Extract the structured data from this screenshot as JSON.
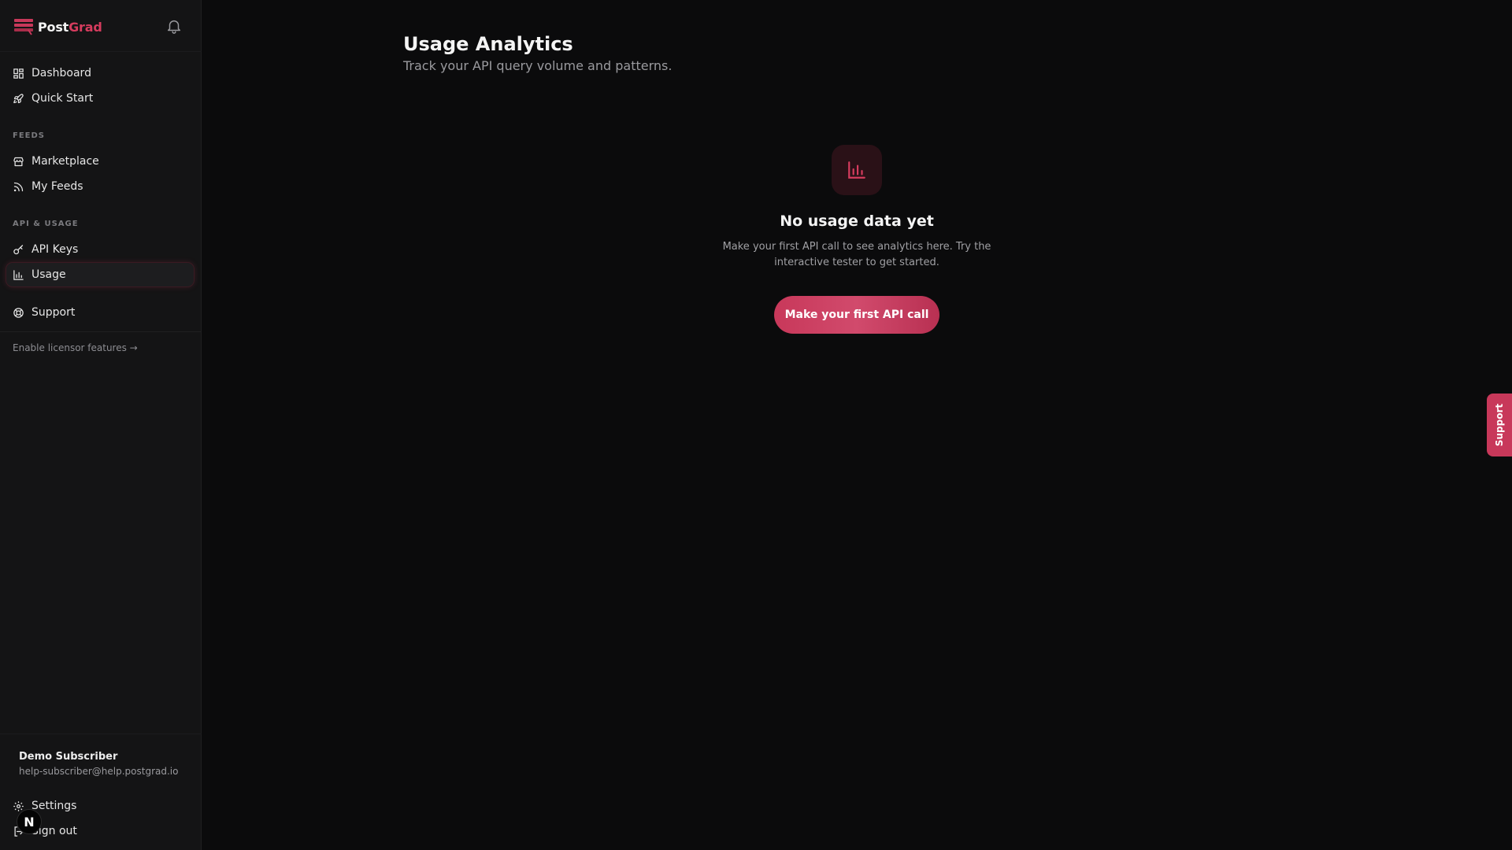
{
  "brand": {
    "name_prefix": "Post",
    "name_suffix": "Grad"
  },
  "sidebar": {
    "primary": [
      {
        "label": "Dashboard",
        "icon": "dashboard-icon"
      },
      {
        "label": "Quick Start",
        "icon": "rocket-icon"
      }
    ],
    "sections": [
      {
        "label": "FEEDS",
        "items": [
          {
            "label": "Marketplace",
            "icon": "store-icon"
          },
          {
            "label": "My Feeds",
            "icon": "rss-icon"
          }
        ]
      },
      {
        "label": "API & USAGE",
        "items": [
          {
            "label": "API Keys",
            "icon": "key-icon"
          },
          {
            "label": "Usage",
            "icon": "bar-chart-icon",
            "active": true
          }
        ]
      }
    ],
    "support": {
      "label": "Support",
      "icon": "lifebuoy-icon"
    },
    "licensor_link": "Enable licensor features →",
    "user": {
      "name": "Demo Subscriber",
      "email": "help-subscriber@help.postgrad.io"
    },
    "footer": [
      {
        "label": "Settings",
        "icon": "gear-icon"
      },
      {
        "label": "Sign out",
        "icon": "sign-out-icon"
      }
    ],
    "badge": "N"
  },
  "main": {
    "title": "Usage Analytics",
    "subtitle": "Track your API query volume and patterns.",
    "empty_state": {
      "title": "No usage data yet",
      "text": "Make your first API call to see analytics here. Try the interactive tester to get started.",
      "button": "Make your first API call"
    }
  },
  "support_tab": {
    "label": "Support"
  },
  "colors": {
    "accent": "#d63c5e",
    "background": "#0b0b0c",
    "sidebar": "#141415"
  }
}
